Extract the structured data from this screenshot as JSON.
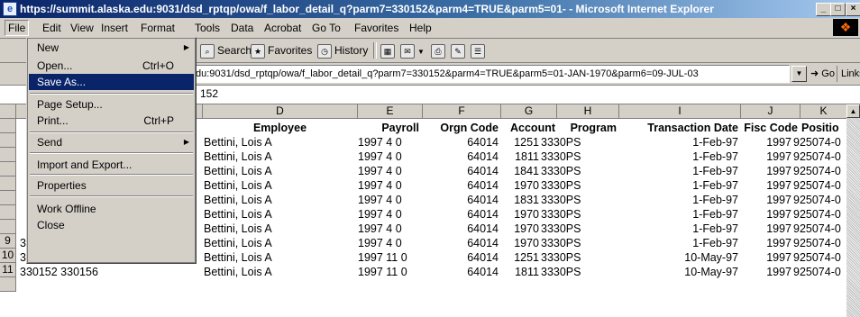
{
  "window": {
    "title": "https://summit.alaska.edu:9031/dsd_rptqp/owa/f_labor_detail_q?parm7=330152&parm4=TRUE&parm5=01- - Microsoft Internet Explorer",
    "controls": [
      "_",
      "□",
      "×"
    ]
  },
  "menubar": {
    "items": [
      "File",
      "Edit",
      "View",
      "Insert",
      "Format",
      "Tools",
      "Data",
      "Acrobat",
      "Go To",
      "Favorites",
      "Help"
    ]
  },
  "toolbar": {
    "search_label": "Search",
    "favorites_label": "Favorites",
    "history_label": "History"
  },
  "address": {
    "url": "du:9031/dsd_rptqp/owa/f_labor_detail_q?parm7=330152&parm4=TRUE&parm5=01-JAN-1970&parm6=09-JUL-03",
    "go_label": "Go",
    "links_label": "Links"
  },
  "formula": {
    "value": "152"
  },
  "file_menu": {
    "items": [
      {
        "label": "New",
        "shortcut": "",
        "submenu": true
      },
      {
        "label": "Open...",
        "shortcut": "Ctrl+O",
        "submenu": false
      },
      {
        "label": "Save As...",
        "shortcut": "",
        "submenu": false,
        "selected": true
      },
      {
        "label": "Page Setup...",
        "shortcut": "",
        "submenu": false
      },
      {
        "label": "Print...",
        "shortcut": "Ctrl+P",
        "submenu": false
      },
      {
        "label": "Send",
        "shortcut": "",
        "submenu": true
      },
      {
        "label": "Import and Export...",
        "shortcut": "",
        "submenu": false
      },
      {
        "label": "Properties",
        "shortcut": "",
        "submenu": false
      },
      {
        "label": "Work Offline",
        "shortcut": "",
        "submenu": false
      },
      {
        "label": "Close",
        "shortcut": "",
        "submenu": false
      }
    ]
  },
  "sheet": {
    "columns": [
      "D",
      "E",
      "F",
      "G",
      "H",
      "I",
      "J",
      "K"
    ],
    "header_row": [
      "Employee",
      "Payroll",
      "Orgn Code",
      "Account",
      "Program",
      "Transaction Date",
      "Fisc Code",
      "Positio"
    ],
    "rows": [
      {
        "num": "",
        "a": "",
        "employee": "Bettini, Lois A",
        "payroll": "1997 4 0",
        "orgn": "64014",
        "account": "1251",
        "program": "3330PS",
        "date": "1-Feb-97",
        "fisc": "1997",
        "pos": "925074-0"
      },
      {
        "num": "",
        "a": "",
        "employee": "Bettini, Lois A",
        "payroll": "1997 4 0",
        "orgn": "64014",
        "account": "1811",
        "program": "3330PS",
        "date": "1-Feb-97",
        "fisc": "1997",
        "pos": "925074-0"
      },
      {
        "num": "",
        "a": "",
        "employee": "Bettini, Lois A",
        "payroll": "1997 4 0",
        "orgn": "64014",
        "account": "1841",
        "program": "3330PS",
        "date": "1-Feb-97",
        "fisc": "1997",
        "pos": "925074-0"
      },
      {
        "num": "",
        "a": "",
        "employee": "Bettini, Lois A",
        "payroll": "1997 4 0",
        "orgn": "64014",
        "account": "1970",
        "program": "3330PS",
        "date": "1-Feb-97",
        "fisc": "1997",
        "pos": "925074-0"
      },
      {
        "num": "",
        "a": "",
        "employee": "Bettini, Lois A",
        "payroll": "1997 4 0",
        "orgn": "64014",
        "account": "1831",
        "program": "3330PS",
        "date": "1-Feb-97",
        "fisc": "1997",
        "pos": "925074-0"
      },
      {
        "num": "",
        "a": "",
        "employee": "Bettini, Lois A",
        "payroll": "1997 4 0",
        "orgn": "64014",
        "account": "1970",
        "program": "3330PS",
        "date": "1-Feb-97",
        "fisc": "1997",
        "pos": "925074-0"
      },
      {
        "num": "",
        "a": "",
        "employee": "Bettini, Lois A",
        "payroll": "1997 4 0",
        "orgn": "64014",
        "account": "1970",
        "program": "3330PS",
        "date": "1-Feb-97",
        "fisc": "1997",
        "pos": "925074-0"
      },
      {
        "num": "9",
        "a": "330152  330156",
        "employee": "Bettini, Lois A",
        "payroll": "1997 4 0",
        "orgn": "64014",
        "account": "1970",
        "program": "3330PS",
        "date": "1-Feb-97",
        "fisc": "1997",
        "pos": "925074-0"
      },
      {
        "num": "10",
        "a": "330152  330156",
        "employee": "Bettini, Lois A",
        "payroll": "1997 11 0",
        "orgn": "64014",
        "account": "1251",
        "program": "3330PS",
        "date": "10-May-97",
        "fisc": "1997",
        "pos": "925074-0"
      },
      {
        "num": "11",
        "a": "330152  330156",
        "employee": "Bettini, Lois A",
        "payroll": "1997 11 0",
        "orgn": "64014",
        "account": "1811",
        "program": "3330PS",
        "date": "10-May-97",
        "fisc": "1997",
        "pos": "925074-0"
      }
    ]
  }
}
